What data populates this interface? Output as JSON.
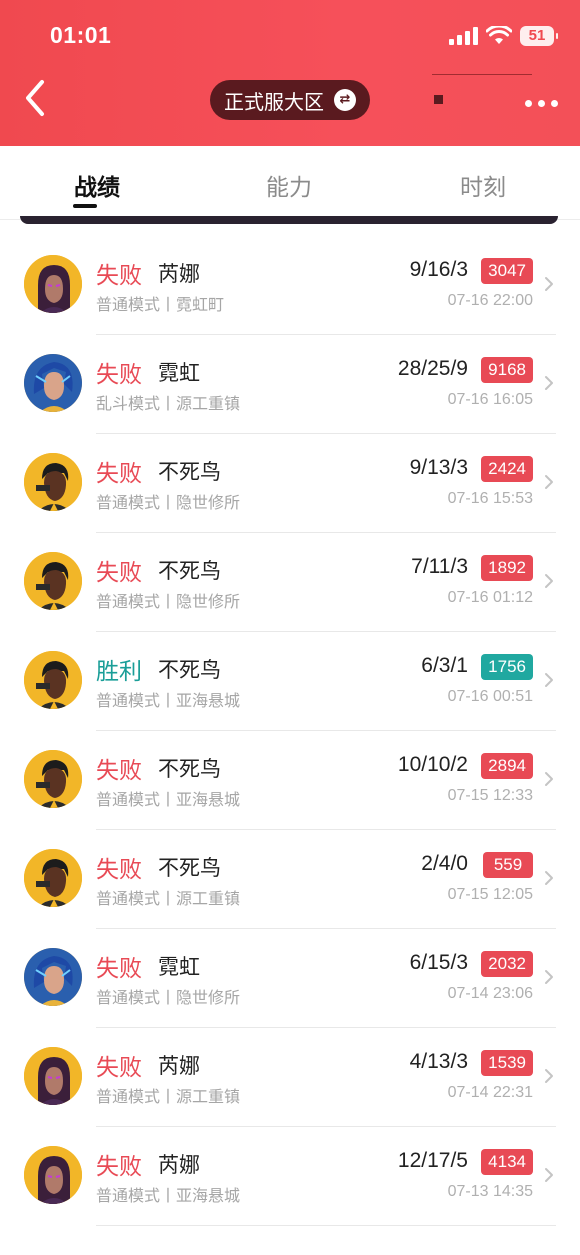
{
  "status_bar": {
    "time": "01:01",
    "battery": "51"
  },
  "header": {
    "server": "正式服大区"
  },
  "tabs": [
    {
      "label": "战绩",
      "active": true
    },
    {
      "label": "能力",
      "active": false
    },
    {
      "label": "时刻",
      "active": false
    }
  ],
  "matches": [
    {
      "result": "失败",
      "outcome": "lose",
      "agent": "芮娜",
      "mode": "普通模式丨霓虹町",
      "kda": "9/16/3",
      "score": "3047",
      "time": "07-16 22:00",
      "avatar": "reyna-avatar-icon"
    },
    {
      "result": "失败",
      "outcome": "lose",
      "agent": "霓虹",
      "mode": "乱斗模式丨源工重镇",
      "kda": "28/25/9",
      "score": "9168",
      "time": "07-16 16:05",
      "avatar": "neon-avatar-icon"
    },
    {
      "result": "失败",
      "outcome": "lose",
      "agent": "不死鸟",
      "mode": "普通模式丨隐世修所",
      "kda": "9/13/3",
      "score": "2424",
      "time": "07-16 15:53",
      "avatar": "phoenix-avatar-icon"
    },
    {
      "result": "失败",
      "outcome": "lose",
      "agent": "不死鸟",
      "mode": "普通模式丨隐世修所",
      "kda": "7/11/3",
      "score": "1892",
      "time": "07-16 01:12",
      "avatar": "phoenix-avatar-icon"
    },
    {
      "result": "胜利",
      "outcome": "win",
      "agent": "不死鸟",
      "mode": "普通模式丨亚海悬城",
      "kda": "6/3/1",
      "score": "1756",
      "time": "07-16 00:51",
      "avatar": "phoenix-avatar-icon"
    },
    {
      "result": "失败",
      "outcome": "lose",
      "agent": "不死鸟",
      "mode": "普通模式丨亚海悬城",
      "kda": "10/10/2",
      "score": "2894",
      "time": "07-15 12:33",
      "avatar": "phoenix-avatar-icon"
    },
    {
      "result": "失败",
      "outcome": "lose",
      "agent": "不死鸟",
      "mode": "普通模式丨源工重镇",
      "kda": "2/4/0",
      "score": "559",
      "time": "07-15 12:05",
      "avatar": "phoenix-avatar-icon"
    },
    {
      "result": "失败",
      "outcome": "lose",
      "agent": "霓虹",
      "mode": "普通模式丨隐世修所",
      "kda": "6/15/3",
      "score": "2032",
      "time": "07-14 23:06",
      "avatar": "neon-avatar-icon"
    },
    {
      "result": "失败",
      "outcome": "lose",
      "agent": "芮娜",
      "mode": "普通模式丨源工重镇",
      "kda": "4/13/3",
      "score": "1539",
      "time": "07-14 22:31",
      "avatar": "reyna-avatar-icon"
    },
    {
      "result": "失败",
      "outcome": "lose",
      "agent": "芮娜",
      "mode": "普通模式丨亚海悬城",
      "kda": "12/17/5",
      "score": "4134",
      "time": "07-13 14:35",
      "avatar": "reyna-avatar-icon"
    }
  ],
  "colors": {
    "header": "#f0494f",
    "lose": "#e84a55",
    "win": "#20a8a0"
  }
}
